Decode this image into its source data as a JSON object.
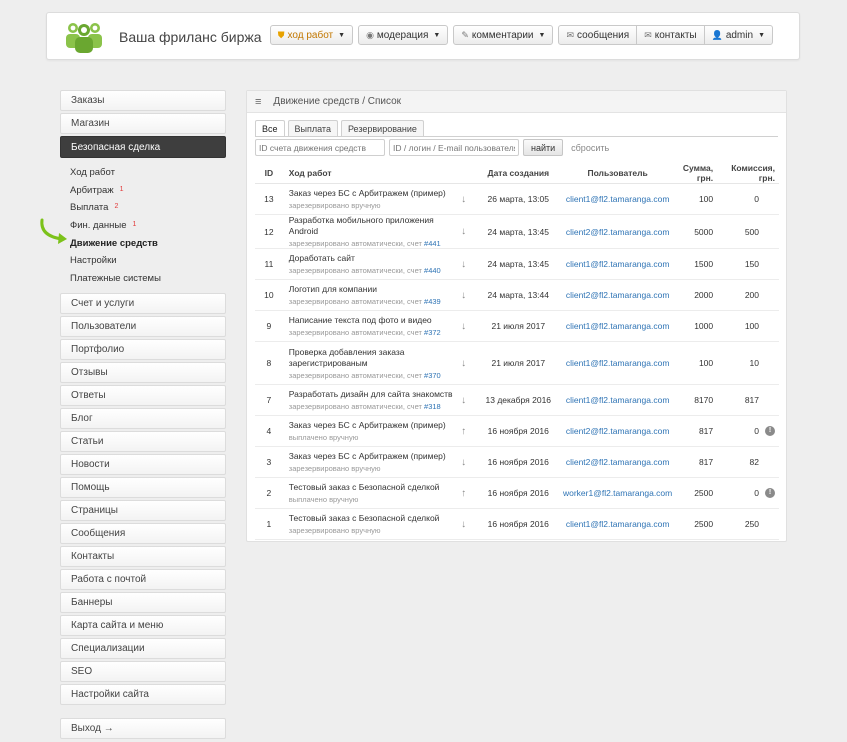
{
  "header": {
    "title": "Ваша фриланс биржа"
  },
  "topnav": {
    "work_progress": "ход работ",
    "moderation": "модерация",
    "comments": "комментарии",
    "messages": "сообщения",
    "contacts": "контакты",
    "admin": "admin"
  },
  "sidebar": {
    "top_items": [
      "Заказы",
      "Магазин"
    ],
    "active": "Безопасная сделка",
    "sub_items": [
      {
        "label": "Ход работ",
        "count": ""
      },
      {
        "label": "Арбитраж",
        "count": "1"
      },
      {
        "label": "Выплата",
        "count": "2"
      },
      {
        "label": "Фин. данные",
        "count": "1"
      },
      {
        "label": "Движение средств",
        "count": ""
      },
      {
        "label": "Настройки",
        "count": ""
      },
      {
        "label": "Платежные системы",
        "count": ""
      }
    ],
    "bottom_items": [
      "Счет и услуги",
      "Пользователи",
      "Портфолио",
      "Отзывы",
      "Ответы",
      "Блог",
      "Статьи",
      "Новости",
      "Помощь",
      "Страницы",
      "Сообщения",
      "Контакты",
      "Работа с почтой",
      "Баннеры",
      "Карта сайта и меню",
      "Специализации",
      "SEO",
      "Настройки сайта"
    ],
    "logout": "Выход →"
  },
  "panel": {
    "breadcrumb": "Движение средств / Список",
    "tabs": [
      "Все",
      "Выплата",
      "Резервирование"
    ],
    "filter_account_placeholder": "ID счета движения средств",
    "filter_user_placeholder": "ID / логин / E-mail пользователя",
    "find_label": "найти",
    "reset_label": "сбросить"
  },
  "table": {
    "headers": {
      "id": "ID",
      "work": "Ход работ",
      "date": "Дата создания",
      "user": "Пользователь",
      "sum": "Сумма, грн.",
      "commission": "Комиссия, грн."
    },
    "rows": [
      {
        "id": "13",
        "title": "Заказ через БС с Арбитражем (пример)",
        "sub": "зарезервировано вручную",
        "link": "",
        "dir": "down",
        "date": "26 марта, 13:05",
        "user": "client1@fl2.tamaranga.com",
        "sum": "100",
        "commission": "0",
        "info": false
      },
      {
        "id": "12",
        "title": "Разработка мобильного приложения Android",
        "sub": "зарезервировано автоматически, счет ",
        "link": "#441",
        "dir": "down",
        "date": "24 марта, 13:45",
        "user": "client2@fl2.tamaranga.com",
        "sum": "5000",
        "commission": "500",
        "info": false
      },
      {
        "id": "11",
        "title": "Доработать сайт",
        "sub": "зарезервировано автоматически, счет ",
        "link": "#440",
        "dir": "down",
        "date": "24 марта, 13:45",
        "user": "client1@fl2.tamaranga.com",
        "sum": "1500",
        "commission": "150",
        "info": false
      },
      {
        "id": "10",
        "title": "Логотип для компании",
        "sub": "зарезервировано автоматически, счет ",
        "link": "#439",
        "dir": "down",
        "date": "24 марта, 13:44",
        "user": "client2@fl2.tamaranga.com",
        "sum": "2000",
        "commission": "200",
        "info": false
      },
      {
        "id": "9",
        "title": "Написание текста под фото и видео",
        "sub": "зарезервировано автоматически, счет ",
        "link": "#372",
        "dir": "down",
        "date": "21 июля 2017",
        "user": "client1@fl2.tamaranga.com",
        "sum": "1000",
        "commission": "100",
        "info": false
      },
      {
        "id": "8",
        "title": "Проверка добавления заказа зарегистрированым",
        "sub": "зарезервировано автоматически, счет ",
        "link": "#370",
        "dir": "down",
        "date": "21 июля 2017",
        "user": "client1@fl2.tamaranga.com",
        "sum": "100",
        "commission": "10",
        "info": false
      },
      {
        "id": "7",
        "title": "Разработать дизайн для сайта знакомств",
        "sub": "зарезервировано автоматически, счет ",
        "link": "#318",
        "dir": "down",
        "date": "13 декабря 2016",
        "user": "client1@fl2.tamaranga.com",
        "sum": "8170",
        "commission": "817",
        "info": false
      },
      {
        "id": "4",
        "title": "Заказ через БС с Арбитражем (пример)",
        "sub": "выплачено вручную",
        "link": "",
        "dir": "up",
        "date": "16 ноября 2016",
        "user": "client2@fl2.tamaranga.com",
        "sum": "817",
        "commission": "0",
        "info": true
      },
      {
        "id": "3",
        "title": "Заказ через БС с Арбитражем (пример)",
        "sub": "зарезервировано вручную",
        "link": "",
        "dir": "down",
        "date": "16 ноября 2016",
        "user": "client2@fl2.tamaranga.com",
        "sum": "817",
        "commission": "82",
        "info": false
      },
      {
        "id": "2",
        "title": "Тестовый заказ с Безопасной сделкой",
        "sub": "выплачено вручную",
        "link": "",
        "dir": "up",
        "date": "16 ноября 2016",
        "user": "worker1@fl2.tamaranga.com",
        "sum": "2500",
        "commission": "0",
        "info": true
      },
      {
        "id": "1",
        "title": "Тестовый заказ с Безопасной сделкой",
        "sub": "зарезервировано вручную",
        "link": "",
        "dir": "down",
        "date": "16 ноября 2016",
        "user": "client1@fl2.tamaranga.com",
        "sum": "2500",
        "commission": "250",
        "info": false
      }
    ]
  }
}
